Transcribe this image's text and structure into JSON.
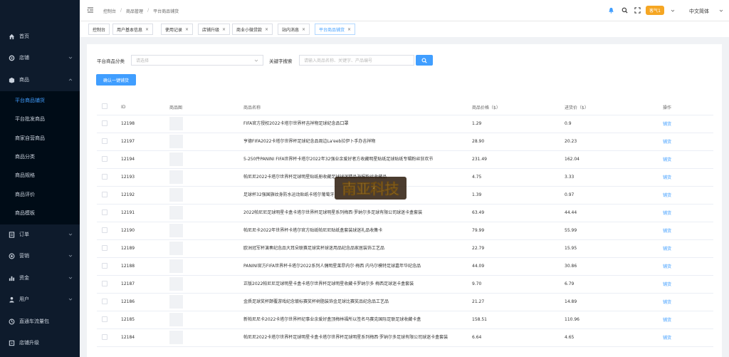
{
  "sidebar": {
    "items": [
      {
        "label": "首页",
        "icon": "home-icon"
      },
      {
        "label": "店铺",
        "icon": "store-icon"
      },
      {
        "label": "商品",
        "icon": "goods-icon"
      },
      {
        "label": "订单",
        "icon": "order-icon"
      },
      {
        "label": "营销",
        "icon": "marketing-icon"
      },
      {
        "label": "资金",
        "icon": "finance-icon"
      },
      {
        "label": "用户",
        "icon": "user-icon"
      },
      {
        "label": "直通车流量包",
        "icon": "traffic-icon"
      },
      {
        "label": "店铺升级",
        "icon": "upgrade-icon"
      }
    ],
    "goods_sub": [
      {
        "label": "平台商品铺货"
      },
      {
        "label": "平台批发商品"
      },
      {
        "label": "商家自营商品"
      },
      {
        "label": "商品分类"
      },
      {
        "label": "商品规格"
      },
      {
        "label": "商品评价"
      },
      {
        "label": "商品模板"
      }
    ]
  },
  "header": {
    "breadcrumb": [
      "控制台",
      "商品管理",
      "平台商品铺货"
    ],
    "badge": "客气1",
    "language": "中文简体"
  },
  "tabs": [
    "控制台",
    "用户基本信息",
    "使用记录",
    "店铺升级",
    "商业小微贷款",
    "站内消息",
    "平台商品铺货"
  ],
  "filters": {
    "category_label": "平台商品分类",
    "category_placeholder": "请选择",
    "keyword_label": "关键字搜索",
    "keyword_placeholder": "请输入商品名称、关键字、产品编号",
    "confirm_button": "确认一键铺货"
  },
  "table": {
    "headers": [
      "ID",
      "商品图",
      "商品名称",
      "商品价格（$）",
      "进货价（$）",
      "操作"
    ],
    "rows": [
      {
        "id": "12198",
        "name": "FIFA官方授权2022卡塔尔世界杯吉祥物足球纪念品口罩",
        "price": "1.29",
        "cost": "0.9",
        "op": "铺货"
      },
      {
        "id": "12197",
        "name": "亨德FIFA2022卡塔尔世界杯足球纪念品周边La'eeb拉伊卜手办吉祥物",
        "price": "28.90",
        "cost": "20.23",
        "op": "铺货"
      },
      {
        "id": "12194",
        "name": "5-250件PANINI FIFA世界杯卡塔尔2022年32强业余爱好者方收藏明星贴纸足球贴纸专辑粉丝狂欢节",
        "price": "231.49",
        "cost": "162.04",
        "op": "铺货"
      },
      {
        "id": "12193",
        "name": "帕尼尼2022卡塔尔世界杯足球明星贴纸册收藏足球球迷精品海报粉丝收藏品",
        "price": "4.75",
        "cost": "3.33",
        "op": "铺货"
      },
      {
        "id": "12192",
        "name": "足球杯32强国旗纹身防水运动贴纸卡塔尔葡萄牙",
        "price": "1.39",
        "cost": "0.97",
        "op": "铺货"
      },
      {
        "id": "12191",
        "name": "2022帕尼尼足球明星卡盒卡塔尔世界杯足球明星系列梅西·罗纳尔多足球有限公司球迷卡盒套装",
        "price": "63.49",
        "cost": "44.44",
        "op": "铺货"
      },
      {
        "id": "12190",
        "name": "帕尼尼卡2022年世界杯卡塔尔官方贴纸帕尼尼贴纸盒套装球迷礼品收集卡",
        "price": "79.99",
        "cost": "55.99",
        "op": "铺货"
      },
      {
        "id": "12189",
        "name": "欧洲冠军杯演奏纪念品大耳朵联赛足球奖杯球迷用品纪念品家居装饰工艺品",
        "price": "22.79",
        "cost": "15.95",
        "op": "铺货"
      },
      {
        "id": "12188",
        "name": "PANINI官方FIFA世界杯卡塔尔2022系列人偶明星莱昂内尔·梅西 内马尔模特足球嘉年华纪念品",
        "price": "44.09",
        "cost": "30.86",
        "op": "铺货"
      },
      {
        "id": "12187",
        "name": "正版2022帕尼尼足球明星卡盒卡塔尔世界杯足球明星收藏卡罗纳尔多 梅西足球迷卡盒套装",
        "price": "9.70",
        "cost": "6.79",
        "op": "铺货"
      },
      {
        "id": "12186",
        "name": "金质足球奖杯颠覆游戏纪念镀标赛奖杯树脂装饰金足球比赛奖品纪念品工艺品",
        "price": "21.27",
        "cost": "14.89",
        "op": "铺货"
      },
      {
        "id": "12185",
        "name": "新帕尼尼卡2022卡塔尔世界杯纪事业余爱好盒顶梅林福所以签名马赛克国际足联足球收藏卡盒",
        "price": "158.51",
        "cost": "110.96",
        "op": "铺货"
      },
      {
        "id": "12184",
        "name": "帕尼尼2022卡塔尔世界杯足球明星卡盒卡塔尔世界杯足球明星系列梅西·罗纳尔多足球有限公司球迷卡盒套装",
        "price": "6.64",
        "cost": "4.65",
        "op": "铺货"
      }
    ]
  },
  "watermark": {
    "text": "南亚科技"
  },
  "colors": {
    "accent": "#409eff",
    "sidebar_bg": "#0e1b2c",
    "badge": "#f5a623"
  }
}
